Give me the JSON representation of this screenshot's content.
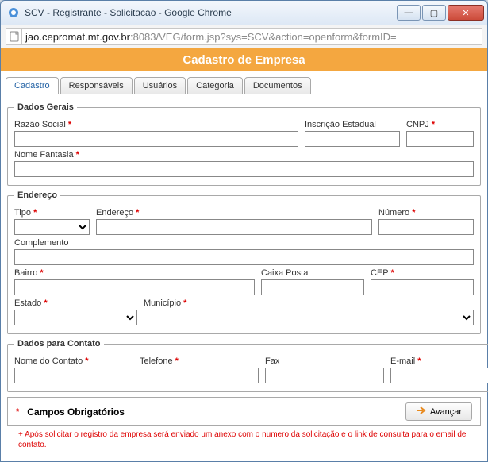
{
  "window": {
    "title": "SCV - Registrante - Solicitacao - Google Chrome",
    "url_host": "jao.cepromat.mt.gov.br",
    "url_rest": ":8083/VEG/form.jsp?sys=SCV&action=openform&formID="
  },
  "banner": "Cadastro de Empresa",
  "tabs": [
    "Cadastro",
    "Responsáveis",
    "Usuários",
    "Categoria",
    "Documentos"
  ],
  "active_tab": "Cadastro",
  "sections": {
    "dados_gerais": {
      "legend": "Dados Gerais",
      "razao_social": "Razão Social",
      "inscricao_estadual": "Inscrição Estadual",
      "cnpj": "CNPJ",
      "nome_fantasia": "Nome Fantasia"
    },
    "endereco": {
      "legend": "Endereço",
      "tipo": "Tipo",
      "endereco": "Endereço",
      "numero": "Número",
      "complemento": "Complemento",
      "bairro": "Bairro",
      "caixa_postal": "Caixa Postal",
      "cep": "CEP",
      "estado": "Estado",
      "municipio": "Município"
    },
    "contato": {
      "legend": "Dados para Contato",
      "nome_contato": "Nome do Contato",
      "telefone": "Telefone",
      "fax": "Fax",
      "email": "E-mail"
    }
  },
  "footer": {
    "req_marker": "*",
    "req_label": "Campos Obrigatórios",
    "advance": "Avançar",
    "note": "+ Após solicitar o registro da empresa será enviado um anexo com o numero da solicitação e o link de consulta para o email de contato."
  }
}
